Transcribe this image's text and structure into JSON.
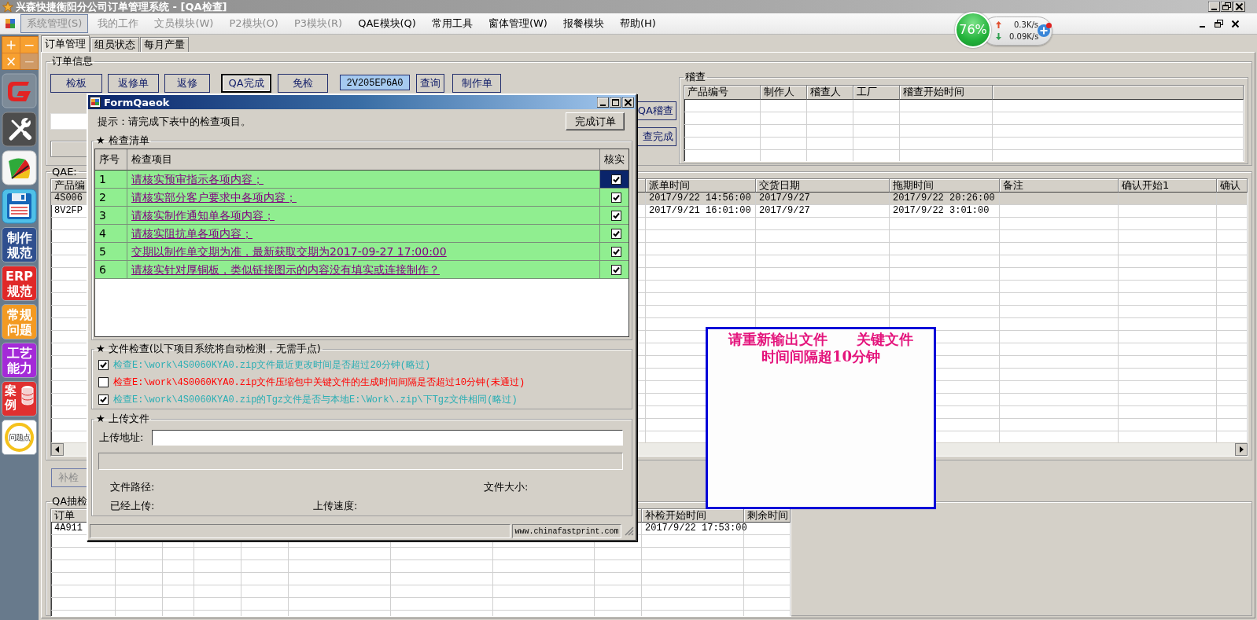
{
  "window": {
    "title": "兴森快捷衡阳分公司订单管理系统 - [QA检查]"
  },
  "menu": [
    {
      "label": "系统管理(S)",
      "selected": true,
      "disabled": true
    },
    {
      "label": "我的工作",
      "selected": false,
      "disabled": true
    },
    {
      "label": "文员模块(W)",
      "selected": false,
      "disabled": true
    },
    {
      "label": "P2模块(O)",
      "selected": false,
      "disabled": true
    },
    {
      "label": "P3模块(R)",
      "selected": false,
      "disabled": true
    },
    {
      "label": "QAE模块(Q)",
      "selected": false,
      "disabled": false
    },
    {
      "label": "常用工具",
      "selected": false,
      "disabled": false
    },
    {
      "label": "窗体管理(W)",
      "selected": false,
      "disabled": false
    },
    {
      "label": "报餐模块",
      "selected": false,
      "disabled": false
    },
    {
      "label": "帮助(H)",
      "selected": false,
      "disabled": false
    }
  ],
  "sidebar": {
    "mdi_buttons": [
      {
        "label": "+",
        "disabled": false
      },
      {
        "label": "−",
        "disabled": false
      },
      {
        "label": "×",
        "disabled": false
      },
      {
        "label": "−",
        "disabled": true
      }
    ],
    "items": [
      {
        "kind": "logo"
      },
      {
        "kind": "tools"
      },
      {
        "kind": "chart"
      },
      {
        "kind": "disk"
      },
      {
        "kind": "label",
        "label": "制作规范",
        "color": "#2f4f8f"
      },
      {
        "kind": "label",
        "label": "ERP规范",
        "color": "#e02828"
      },
      {
        "kind": "label",
        "label": "常规问题",
        "color": "#f39a22"
      },
      {
        "kind": "label",
        "label": "工艺能力",
        "color": "#a42ad8"
      },
      {
        "kind": "case",
        "label": "案例"
      },
      {
        "kind": "bulb",
        "label": "问题点"
      }
    ]
  },
  "tabs": [
    {
      "label": "订单管理",
      "selected": true
    },
    {
      "label": "组员状态",
      "selected": false
    },
    {
      "label": "每月产量",
      "selected": false
    }
  ],
  "order_info": {
    "title": "订单信息",
    "buttons": [
      {
        "label": "检板",
        "selected": false
      },
      {
        "label": "返修单",
        "selected": false
      },
      {
        "label": "返修",
        "selected": false
      },
      {
        "label": "QA完成",
        "selected": true
      },
      {
        "label": "免检",
        "selected": false
      }
    ],
    "order_number": "2V205EP6A0",
    "actions": [
      "查询",
      "制作单"
    ],
    "audit_buttons": [
      "QA稽查",
      "查完成"
    ]
  },
  "audit": {
    "title": "稽查",
    "columns": [
      "产品编号",
      "制作人",
      "稽查人",
      "工厂",
      "稽查开始时间"
    ]
  },
  "qae": {
    "title": "QAE:",
    "columns": [
      "产品编",
      "派单时间",
      "交货日期",
      "拖期时间",
      "备注",
      "确认开始1",
      "确认"
    ],
    "rows": [
      {
        "cells": [
          "4S006",
          "2017/9/22 14:56:00",
          "2017/9/27",
          "2017/9/22 20:26:00"
        ],
        "selected": true
      },
      {
        "cells": [
          "8V2FP",
          "2017/9/21 16:01:00",
          "2017/9/27",
          "2017/9/22 3:01:00"
        ],
        "selected": false
      }
    ]
  },
  "recheck_button": {
    "label": "补检",
    "disabled": true
  },
  "qa_sampling": {
    "title": "QA抽检",
    "columns": [
      "订单",
      "补检开始时间",
      "剩余时间"
    ],
    "rows": [
      {
        "cells": [
          "4A911",
          "2017/9/22 17:53:00"
        ]
      }
    ]
  },
  "dialog": {
    "title": "FormQaeok",
    "hint": "提示：请完成下表中的检查项目。",
    "finish_button": "完成订单",
    "checklist": {
      "title": "★ 检查清单",
      "columns": [
        "序号",
        "检查项目",
        "核实"
      ],
      "rows": [
        {
          "no": "1",
          "item": "请核实预审指示各项内容；",
          "checked": true,
          "selected": true
        },
        {
          "no": "2",
          "item": "请核实部分客户要求中各项内容；",
          "checked": true,
          "selected": false
        },
        {
          "no": "3",
          "item": "请核实制作通知单各项内容；",
          "checked": true,
          "selected": false
        },
        {
          "no": "4",
          "item": "请核实阻抗单各项内容；",
          "checked": true,
          "selected": false
        },
        {
          "no": "5",
          "item": "交期以制作单交期为准，最新获取交期为2017-09-27 17:00:00",
          "checked": true,
          "selected": false
        },
        {
          "no": "6",
          "item": "请核实针对厚铜板，类似链接图示的内容没有填实或连接制作？",
          "checked": true,
          "selected": false
        }
      ]
    },
    "file_check": {
      "title": "★ 文件检查(以下项目系统将自动检测，无需手点)",
      "items": [
        {
          "text": "检查E:\\work\\4S0060KYA0.zip文件最近更改时间是否超过20分钟(略过)",
          "checked": true,
          "color": "#2aaeb4"
        },
        {
          "text": "检查E:\\work\\4S0060KYA0.zip文件压缩包中关键文件的生成时间间隔是否超过10分钟(未通过)",
          "checked": false,
          "color": "#ff0000"
        },
        {
          "text": "检查E:\\work\\4S0060KYA0.zip的Tgz文件是否与本地E:\\Work\\.zip\\下Tgz文件相同(略过)",
          "checked": true,
          "color": "#2aaeb4"
        }
      ]
    },
    "upload": {
      "title": "★ 上传文件",
      "address_label": "上传地址:",
      "level": 0,
      "file_path_label": "文件路径:",
      "file_size_label": "文件大小:",
      "uploaded_label": "已经上传:",
      "speed_label": "上传速度:"
    },
    "status_url": "www.chinafastprint.com"
  },
  "alert": {
    "lines": [
      "请重新输出文件      关键文件",
      "时间间隔超10分钟"
    ]
  },
  "net_widget": {
    "usage": "76%",
    "upload": "0.3K/s",
    "download": "0.09K/s"
  }
}
